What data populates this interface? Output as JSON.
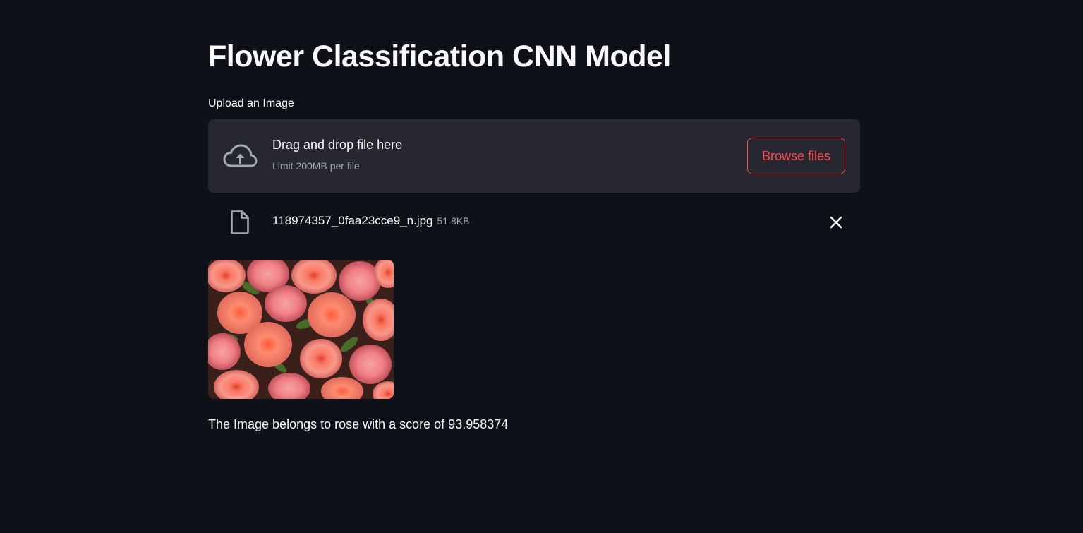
{
  "page": {
    "title": "Flower Classification CNN Model"
  },
  "uploader": {
    "label": "Upload an Image",
    "drop_text": "Drag and drop file here",
    "limit_text": "Limit 200MB per file",
    "browse_label": "Browse files",
    "icon": "cloud-upload-icon"
  },
  "uploaded_file": {
    "name": "118974357_0faa23cce9_n.jpg",
    "size": "51.8KB",
    "icon": "file-icon",
    "remove_icon": "close-icon"
  },
  "result": {
    "text": "The Image belongs to rose with a score of 93.958374"
  },
  "colors": {
    "background": "#0e1117",
    "panel": "#262730",
    "accent": "#ff4b4b",
    "text": "#fafafa",
    "muted": "#a3a8b8"
  }
}
